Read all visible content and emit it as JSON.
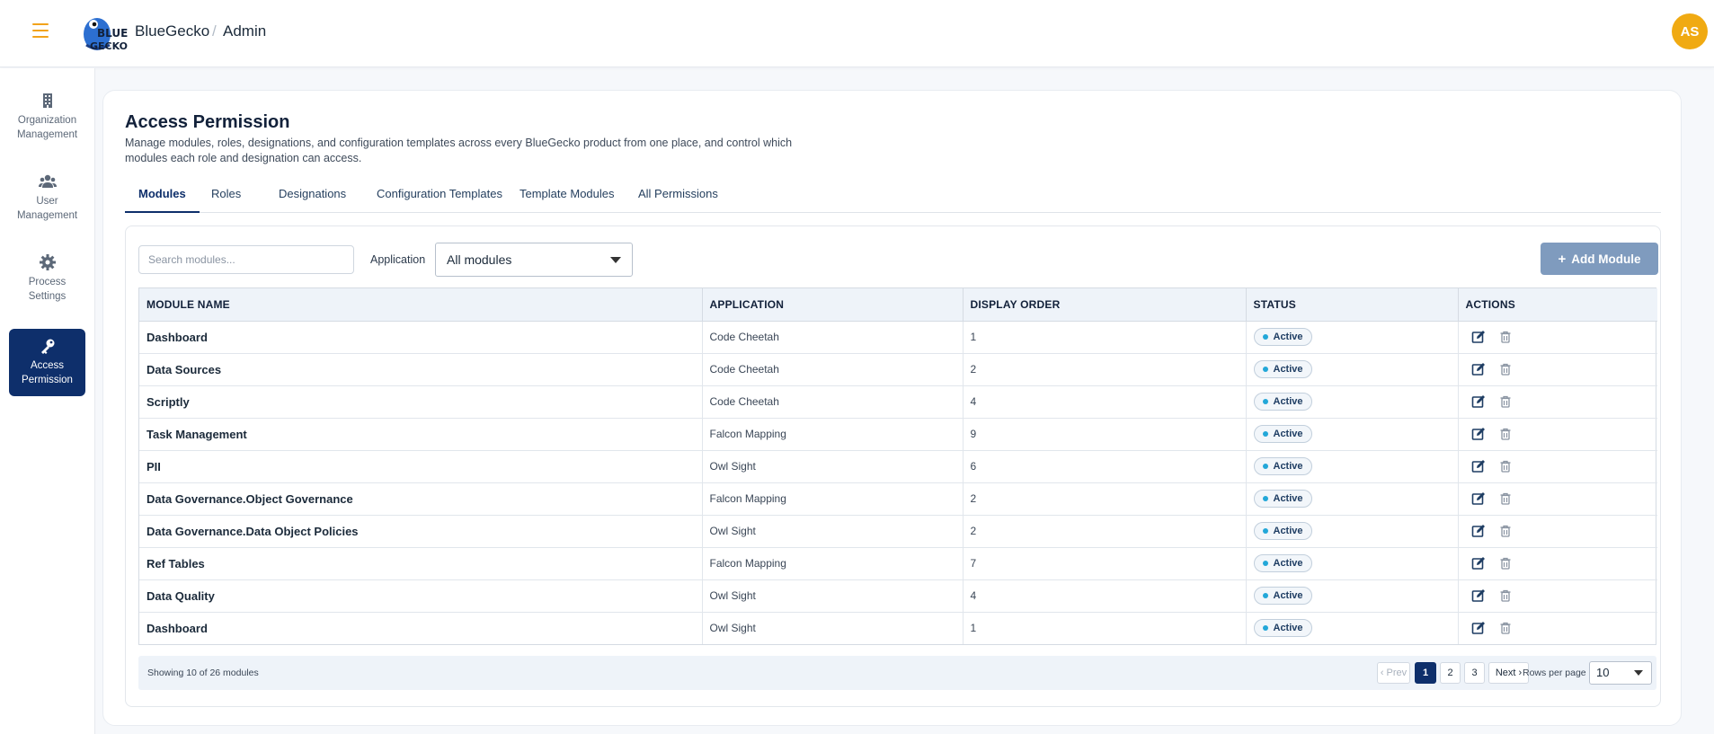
{
  "header": {
    "brand": "BlueGecko",
    "separator": "/",
    "section": "Admin",
    "avatar_initials": "AS",
    "logo_text_top": "BLUE",
    "logo_text_bottom": "GECKO"
  },
  "sidebar": {
    "items": [
      {
        "label_line1": "Organization",
        "label_line2": "Management",
        "icon": "building-icon",
        "active": false
      },
      {
        "label_line1": "User",
        "label_line2": "Management",
        "icon": "users-icon",
        "active": false
      },
      {
        "label_line1": "Process",
        "label_line2": "Settings",
        "icon": "gear-icon",
        "active": false
      },
      {
        "label_line1": "Access",
        "label_line2": "Permission",
        "icon": "key-icon",
        "active": true
      }
    ]
  },
  "page": {
    "title": "Access Permission",
    "description": "Manage modules, roles, designations, and configuration templates across every BlueGecko product from one place, and control which modules each role and designation can access."
  },
  "tabs": [
    "Modules",
    "Roles",
    "Designations",
    "Configuration Templates",
    "Template Modules",
    "All Permissions"
  ],
  "active_tab": "Modules",
  "toolbar": {
    "search_placeholder": "Search modules...",
    "application_label": "Application",
    "application_selected": "All modules",
    "add_label": "Add Module"
  },
  "table": {
    "headers": [
      "MODULE NAME",
      "APPLICATION",
      "DISPLAY ORDER",
      "STATUS",
      "ACTIONS"
    ],
    "rows": [
      {
        "name": "Dashboard",
        "application": "Code Cheetah",
        "order": "1",
        "status": "Active"
      },
      {
        "name": "Data Sources",
        "application": "Code Cheetah",
        "order": "2",
        "status": "Active"
      },
      {
        "name": "Scriptly",
        "application": "Code Cheetah",
        "order": "4",
        "status": "Active"
      },
      {
        "name": "Task Management",
        "application": "Falcon Mapping",
        "order": "9",
        "status": "Active"
      },
      {
        "name": "PII",
        "application": "Owl Sight",
        "order": "6",
        "status": "Active"
      },
      {
        "name": "Data Governance.Object Governance",
        "application": "Falcon Mapping",
        "order": "2",
        "status": "Active"
      },
      {
        "name": "Data Governance.Data Object Policies",
        "application": "Owl Sight",
        "order": "2",
        "status": "Active"
      },
      {
        "name": "Ref Tables",
        "application": "Falcon Mapping",
        "order": "7",
        "status": "Active"
      },
      {
        "name": "Data Quality",
        "application": "Owl Sight",
        "order": "4",
        "status": "Active"
      },
      {
        "name": "Dashboard",
        "application": "Owl Sight",
        "order": "1",
        "status": "Active"
      }
    ]
  },
  "pagination": {
    "showing": "Showing 10 of 26 modules",
    "prev": "‹ Prev",
    "pages": [
      "1",
      "2",
      "3"
    ],
    "current": "1",
    "next": "Next ›",
    "rows_per_page_label": "Rows per page",
    "rows_per_page": "10"
  },
  "colors": {
    "brand_navy": "#0e2f6b",
    "accent_orange": "#f2a31b",
    "avatar": "#f0aa12",
    "add_button": "#7f9bbe",
    "status_dot": "#22a7d8",
    "edit_icon": "#1e3d63",
    "delete_icon": "#8a94a2"
  }
}
